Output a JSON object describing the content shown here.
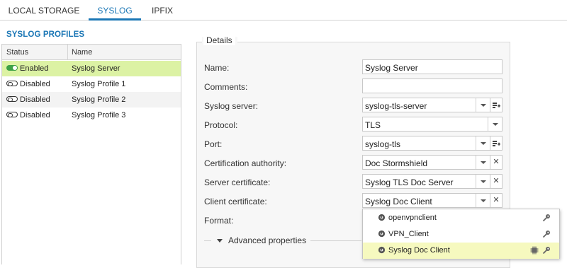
{
  "tabs": [
    {
      "label": "LOCAL STORAGE"
    },
    {
      "label": "SYSLOG"
    },
    {
      "label": "IPFIX"
    }
  ],
  "profiles_title": "SYSLOG PROFILES",
  "grid": {
    "col_status": "Status",
    "col_name": "Name",
    "rows": [
      {
        "status": "Enabled",
        "name": "Syslog Server"
      },
      {
        "status": "Disabled",
        "name": "Syslog Profile 1"
      },
      {
        "status": "Disabled",
        "name": "Syslog Profile 2"
      },
      {
        "status": "Disabled",
        "name": "Syslog Profile 3"
      }
    ]
  },
  "details": {
    "legend": "Details",
    "name": {
      "label": "Name:",
      "value": "Syslog Server"
    },
    "comments": {
      "label": "Comments:",
      "value": ""
    },
    "server": {
      "label": "Syslog server:",
      "value": "syslog-tls-server"
    },
    "protocol": {
      "label": "Protocol:",
      "value": "TLS"
    },
    "port": {
      "label": "Port:",
      "value": "syslog-tls"
    },
    "ca": {
      "label": "Certification authority:",
      "value": "Doc Stormshield"
    },
    "server_cert": {
      "label": "Server certificate:",
      "value": "Syslog TLS Doc Server"
    },
    "client_cert": {
      "label": "Client certificate:",
      "value": "Syslog Doc Client"
    },
    "format": {
      "label": "Format:"
    },
    "advanced": "Advanced properties"
  },
  "dropdown": {
    "options": [
      {
        "label": "openvpnclient"
      },
      {
        "label": "VPN_Client"
      },
      {
        "label": "Syslog Doc Client"
      }
    ]
  },
  "colors": {
    "accent": "#1a76b5",
    "selected_row": "#dcf2a4",
    "enabled": "#3ea246",
    "option_highlight": "#f6f9bf"
  },
  "icons": [
    "toggle-on-icon",
    "toggle-off-icon",
    "dropdown-arrow-icon",
    "add-object-icon",
    "clear-icon",
    "certificate-gear-icon",
    "key-icon",
    "chip-icon"
  ]
}
